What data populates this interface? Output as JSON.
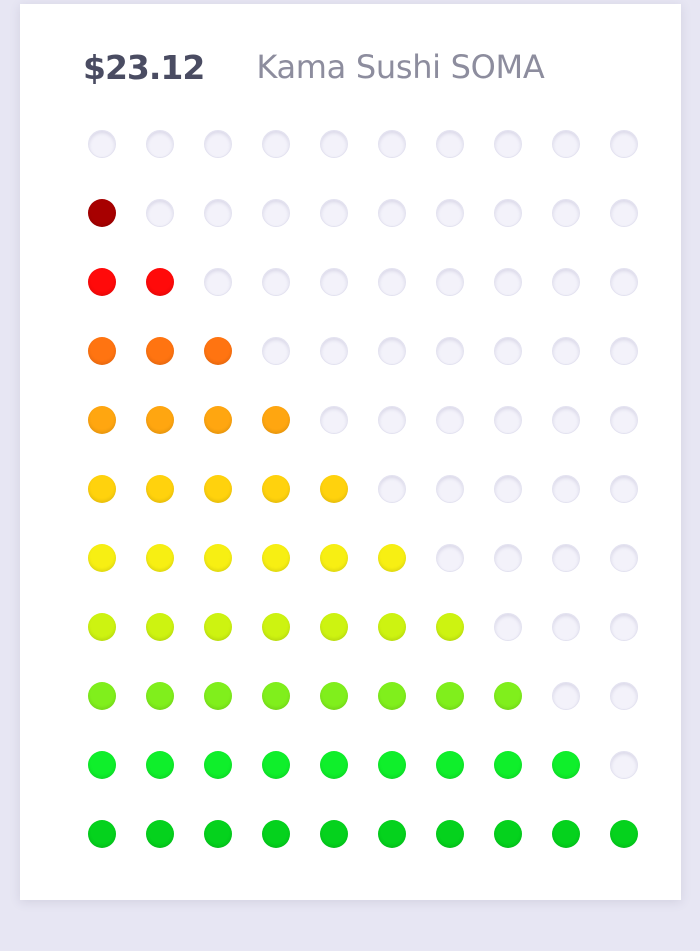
{
  "summary": {
    "amount": "$23.12",
    "venue": "Kama Sushi SOMA"
  },
  "grid": {
    "columns": 10,
    "empty_color": "#f3f2fa",
    "rows": [
      {
        "filled": 0,
        "color": "#f3f2fa"
      },
      {
        "filled": 1,
        "color": "#a70000"
      },
      {
        "filled": 2,
        "color": "#ff0a0a"
      },
      {
        "filled": 3,
        "color": "#ff7411"
      },
      {
        "filled": 4,
        "color": "#ffa610"
      },
      {
        "filled": 5,
        "color": "#ffd20d"
      },
      {
        "filled": 6,
        "color": "#f7ef13"
      },
      {
        "filled": 7,
        "color": "#cdf311"
      },
      {
        "filled": 8,
        "color": "#80ef1c"
      },
      {
        "filled": 9,
        "color": "#0fef2b"
      },
      {
        "filled": 10,
        "color": "#05d21d"
      }
    ]
  }
}
